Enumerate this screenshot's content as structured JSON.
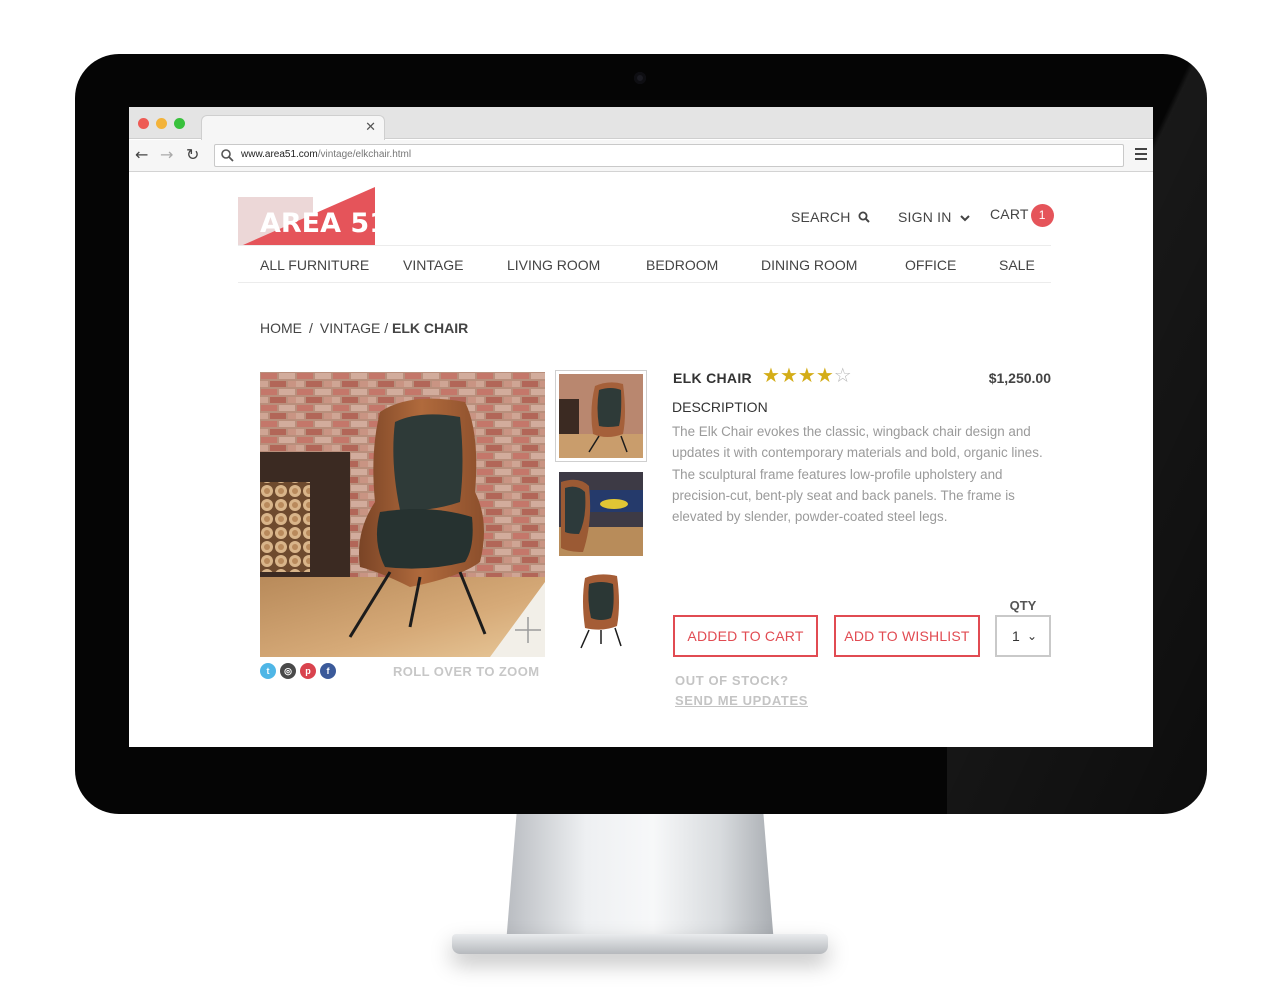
{
  "browser": {
    "url_domain": "www.area51.com",
    "url_path": "/vintage/elkchair.html"
  },
  "site": {
    "logo_text": "AREA 51",
    "header": {
      "search_label": "SEARCH",
      "signin_label": "SIGN IN",
      "cart_label": "CART",
      "cart_count": "1"
    },
    "nav": [
      "ALL FURNITURE",
      "VINTAGE",
      "LIVING ROOM",
      "BEDROOM",
      "DINING ROOM",
      "OFFICE",
      "SALE"
    ],
    "breadcrumb": {
      "home": "HOME",
      "sep": "/",
      "category": "VINTAGE",
      "current": "ELK CHAIR"
    },
    "gallery": {
      "zoom_hint": "ROLL OVER TO ZOOM",
      "social_icons": [
        "twitter-icon",
        "instagram-icon",
        "pinterest-icon",
        "facebook-icon"
      ]
    },
    "product": {
      "name": "ELK CHAIR",
      "rating": 4,
      "rating_max": 5,
      "price": "$1,250.00",
      "description_heading": "DESCRIPTION",
      "description": "The Elk Chair evokes the classic, wingback chair design and updates it with contemporary materials and bold, organic lines. The sculptural frame features low-profile upholstery and precision-cut, bent-ply seat and back panels.  The frame is elevated by slender, powder-coated steel legs.",
      "added_to_cart_label": "ADDED TO CART",
      "wishlist_label": "ADD TO WISHLIST",
      "qty_label": "QTY",
      "qty_value": "1",
      "out_of_stock": "OUT OF STOCK?",
      "send_updates": "SEND ME UPDATES"
    },
    "colors": {
      "accent": "#e14b52",
      "star": "#d4ad18",
      "muted_text": "#9a9a9a"
    }
  }
}
